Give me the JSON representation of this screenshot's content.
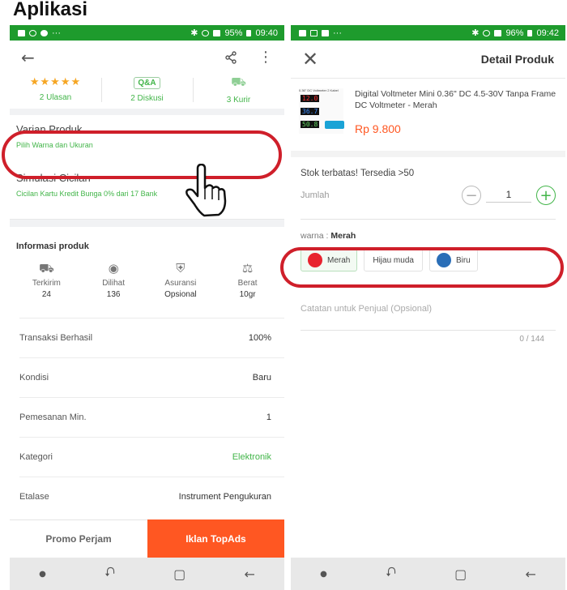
{
  "page_title": "Aplikasi",
  "left": {
    "status": {
      "battery": "95%",
      "time": "09:40",
      "dots": "···"
    },
    "stats": [
      {
        "label": "2 Ulasan"
      },
      {
        "badge": "Q&A",
        "label": "2 Diskusi"
      },
      {
        "label": "3 Kurir"
      }
    ],
    "varian": {
      "title": "Varian Produk",
      "sub": "Pilih Warna dan Ukuran"
    },
    "cicilan": {
      "title": "Simulasi Cicilan",
      "sub": "Cicilan Kartu Kredit Bunga 0% dari 17 Bank"
    },
    "info_title": "Informasi produk",
    "info_icons": [
      {
        "label": "Terkirim",
        "value": "24"
      },
      {
        "label": "Dilihat",
        "value": "136"
      },
      {
        "label": "Asuransi",
        "value": "Opsional"
      },
      {
        "label": "Berat",
        "value": "10gr"
      }
    ],
    "rows": [
      {
        "label": "Transaksi Berhasil",
        "value": "100%"
      },
      {
        "label": "Kondisi",
        "value": "Baru"
      },
      {
        "label": "Pemesanan Min.",
        "value": "1"
      },
      {
        "label": "Kategori",
        "value": "Elektronik"
      },
      {
        "label": "Etalase",
        "value": "Instrument Pengukuran"
      }
    ],
    "promo_label": "Promo Perjam",
    "topads_label": "Iklan TopAds"
  },
  "right": {
    "status": {
      "battery": "96%",
      "time": "09:42",
      "dots": "···"
    },
    "title": "Detail Produk",
    "thumb_caption": "0.36\" DC Voltmeter 2 Kabel",
    "thumb_digits": [
      "12.0",
      "36.7",
      "50.8"
    ],
    "product_name": "Digital Voltmeter Mini 0.36\" DC 4.5-30V Tanpa Frame DC Voltmeter - Merah",
    "price": "Rp 9.800",
    "stock": "Stok terbatas! Tersedia >50",
    "qty_label": "Jumlah",
    "qty_value": "1",
    "warna_label": "warna :",
    "warna_value": "Merah",
    "chips": [
      {
        "label": "Merah",
        "color": "#e8232f"
      },
      {
        "label": "Hijau muda"
      },
      {
        "label": "Biru",
        "color": "#2a6eb7"
      }
    ],
    "catatan_placeholder": "Catatan untuk Penjual (Opsional)",
    "counter": "0 / 144"
  },
  "colors": {
    "green": "#42b549",
    "orange": "#ff5722",
    "status": "#1e9b2d",
    "highlight": "#cf1f2a"
  }
}
